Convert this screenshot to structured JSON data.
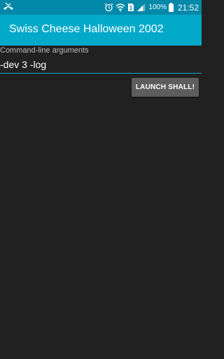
{
  "status_bar": {
    "left_icon": "missed-call-icon",
    "icons": [
      "alarm-icon",
      "wifi-icon",
      "sim-icon",
      "signal-icon",
      "battery-icon"
    ],
    "sim_label": "1",
    "battery": "100%",
    "time": "21:52"
  },
  "app_bar": {
    "title": "Swiss Cheese Halloween 2002"
  },
  "form": {
    "args_label": "Command-line arguments",
    "args_value": "-dev 3 -log",
    "launch_label": "LAUNCH SHALL!"
  },
  "colors": {
    "status_bar": "#0288a8",
    "app_bar": "#03a9c9",
    "background": "#212121",
    "accent": "#0fa7c8",
    "button": "#5d5d5d"
  }
}
